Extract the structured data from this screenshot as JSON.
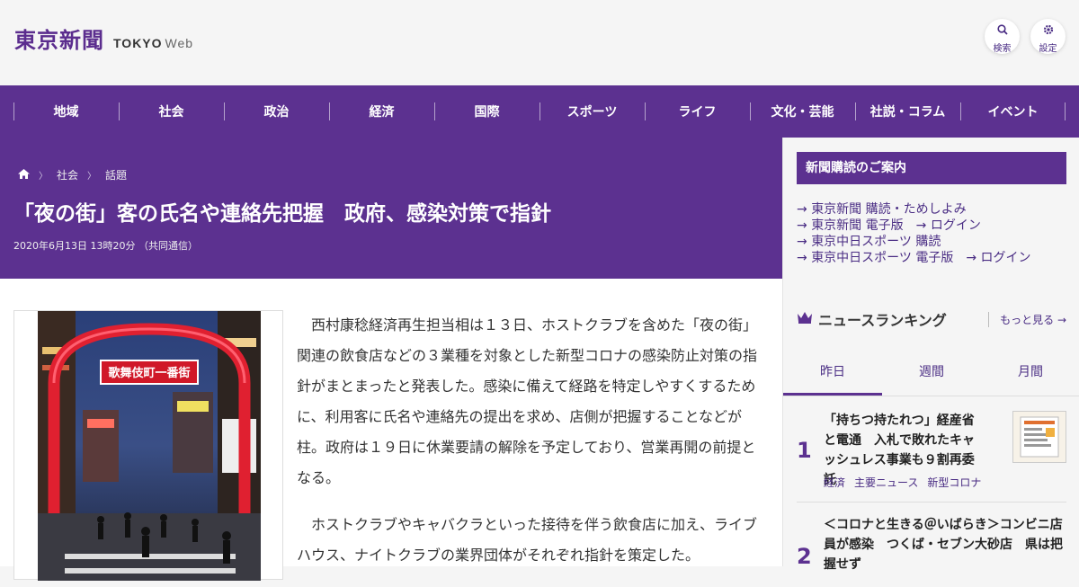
{
  "header": {
    "logo_kanji": "東京新聞",
    "logo_en": "TOKYO",
    "logo_web": "Web",
    "search_label": "検索",
    "settings_label": "設定"
  },
  "nav": [
    "地域",
    "社会",
    "政治",
    "経済",
    "国際",
    "スポーツ",
    "ライフ",
    "文化・芸能",
    "社説・コラム",
    "イベント"
  ],
  "article": {
    "breadcrumb": [
      "社会",
      "話題"
    ],
    "title": "「夜の街」客の氏名や連絡先把握　政府、感染対策で指針",
    "meta": "2020年6月13日 13時20分 （共同通信）",
    "photo_sign": "歌舞伎町一番街",
    "paragraphs": [
      "西村康稔経済再生担当相は１３日、ホストクラブを含めた「夜の街」関連の飲食店などの３業種を対象とした新型コロナの感染防止対策の指針がまとまったと発表した。感染に備えて経路を特定しやすくするために、利用客に氏名や連絡先の提出を求め、店側が把握することなどが柱。政府は１９日に休業要請の解除を予定しており、営業再開の前提となる。",
      "ホストクラブやキャバクラといった接待を伴う飲食店に加え、ライブハウス、ナイトクラブの業界団体がそれぞれ指針を策定した。"
    ]
  },
  "sidebar": {
    "subscribe_heading": "新聞購読のご案内",
    "links": [
      [
        "東京新聞 購読・ためしよみ"
      ],
      [
        "東京新聞 電子版",
        "ログイン"
      ],
      [
        "東京中日スポーツ 購読"
      ],
      [
        "東京中日スポーツ 電子版",
        "ログイン"
      ]
    ],
    "ranking_title": "ニュースランキング",
    "more_label": "もっと見る",
    "tabs": [
      "昨日",
      "週間",
      "月間"
    ],
    "ranking": [
      {
        "num": "1",
        "title": "「持ちつ持たれつ」経産省と電通　入札で敗れたキャッシュレス事業も９割再委託",
        "tags": [
          "経済",
          "主要ニュース",
          "新型コロナ"
        ]
      },
      {
        "num": "2",
        "title": "＜コロナと生きる＠いばらき＞コンビニ店員が感染　つくば・セブン大砂店　県は把握せず",
        "tags": []
      }
    ]
  },
  "colors": {
    "brand_purple": "#5c3190",
    "link_purple": "#4a2d84"
  }
}
